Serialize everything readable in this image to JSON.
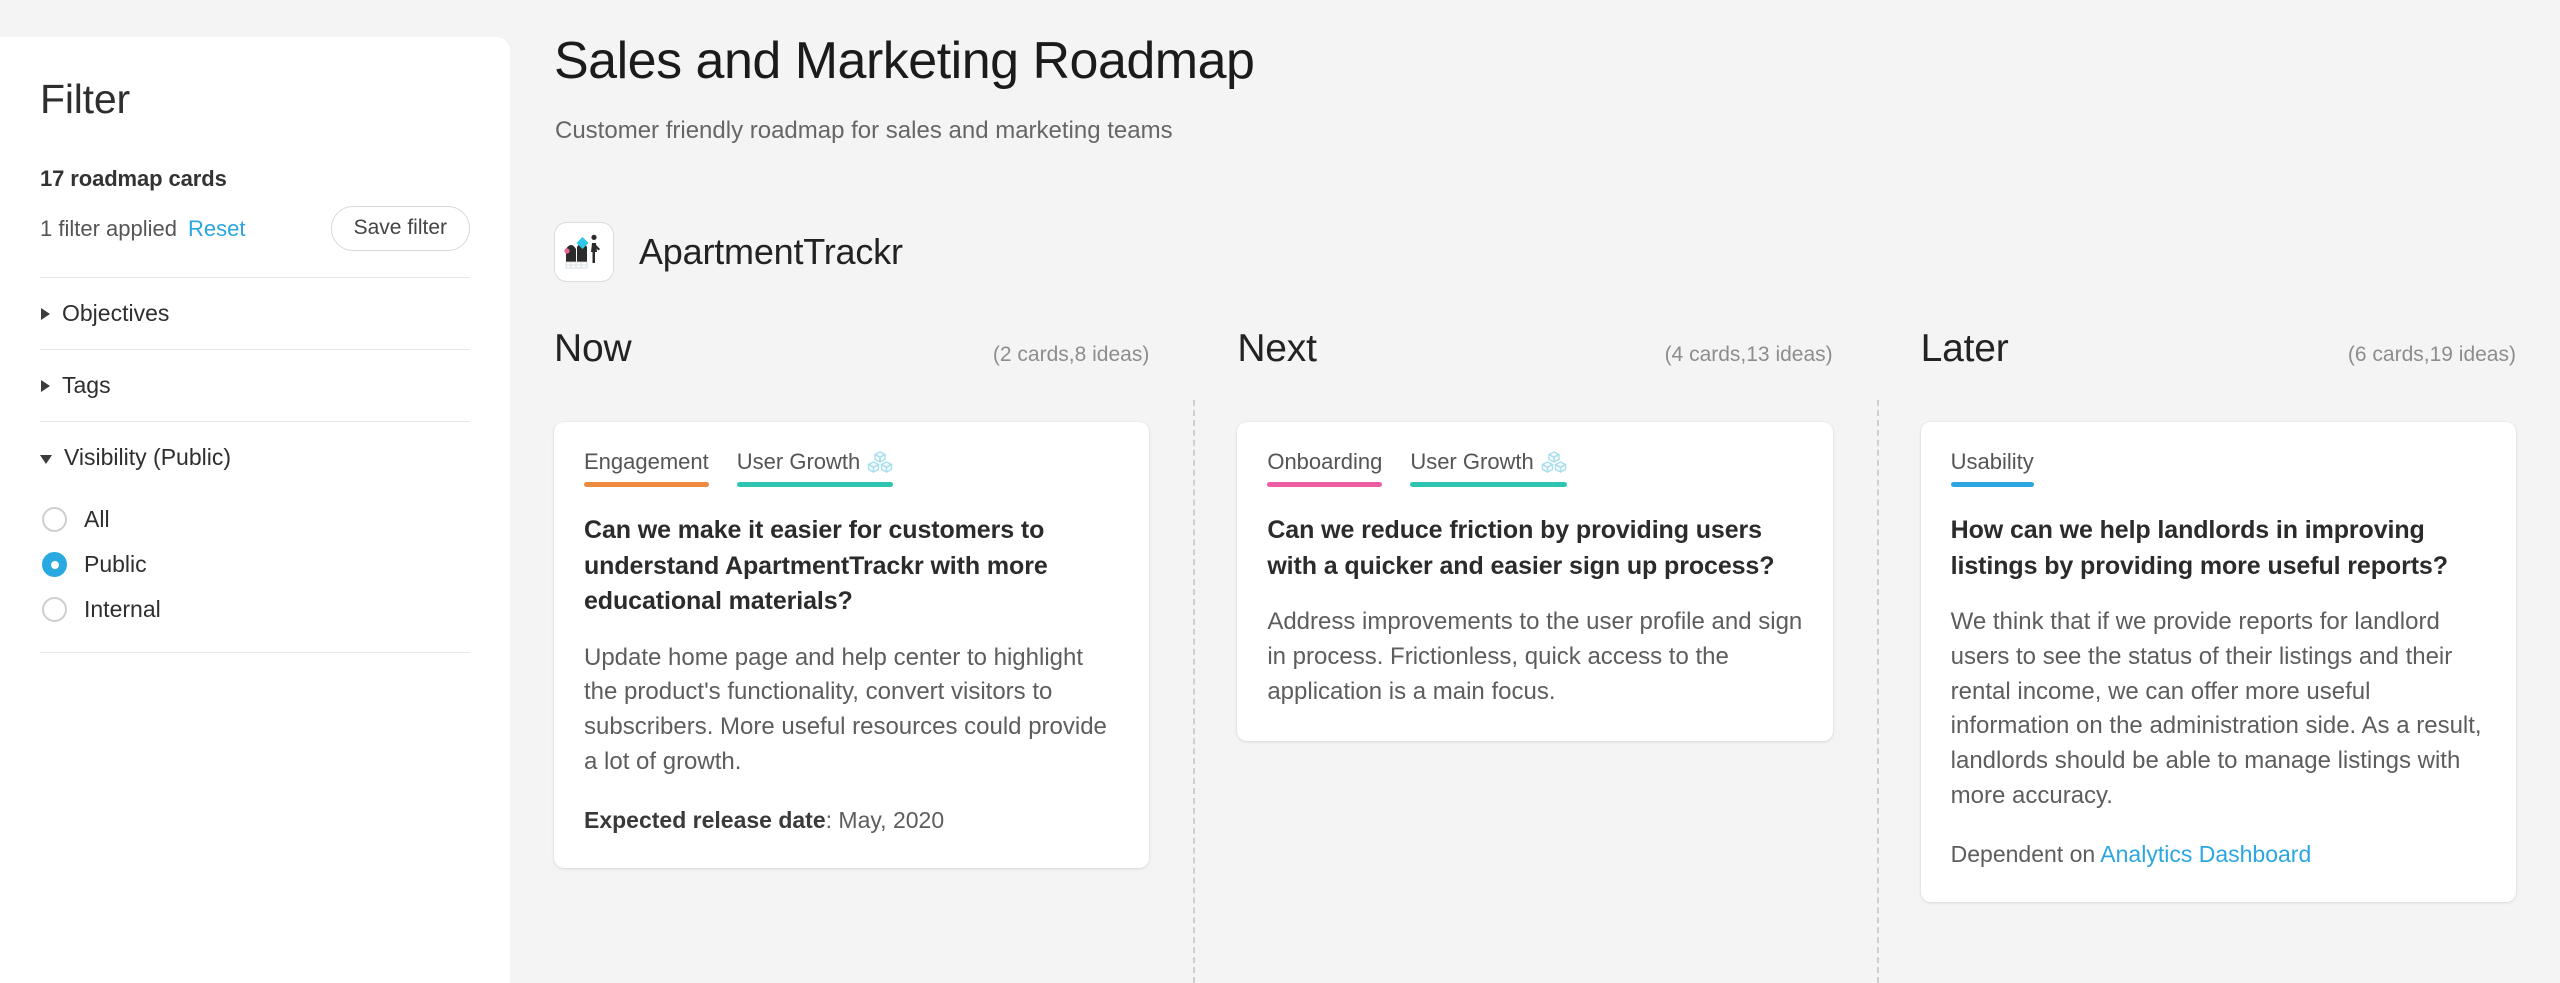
{
  "filter_panel": {
    "title": "Filter",
    "card_count": "17 roadmap cards",
    "filters_applied": "1 filter applied",
    "reset_label": "Reset",
    "save_filter_label": "Save filter",
    "sections": [
      {
        "label": "Objectives",
        "expanded": false
      },
      {
        "label": "Tags",
        "expanded": false
      },
      {
        "label": "Visibility (Public)",
        "expanded": true
      }
    ],
    "visibility_options": [
      {
        "label": "All",
        "selected": false
      },
      {
        "label": "Public",
        "selected": true
      },
      {
        "label": "Internal",
        "selected": false
      }
    ],
    "accent_color": "#29a9e0",
    "link_color": "#2ba6e0"
  },
  "header": {
    "title": "Sales and Marketing Roadmap",
    "subtitle": "Customer friendly roadmap for sales and marketing teams"
  },
  "product": {
    "name": "ApartmentTrackr",
    "logo_icon": "apartment-buildings-icon"
  },
  "columns": [
    {
      "title": "Now",
      "meta": "(2 cards,8 ideas)",
      "card": {
        "tags": [
          {
            "label": "Engagement",
            "color": "#ef8b3f",
            "has_objective_icon": false
          },
          {
            "label": "User Growth",
            "color": "#2ec4b1",
            "has_objective_icon": true
          }
        ],
        "title": "Can we make it easier for customers to understand ApartmentTrackr with more educational materials?",
        "description": "Update home page and help center to highlight the product's functionality, convert visitors to subscribers. More useful resources could provide a lot of growth.",
        "footer_label": "Expected release date",
        "footer_separator": ": ",
        "footer_value": "May, 2020",
        "footer_link": ""
      }
    },
    {
      "title": "Next",
      "meta": "(4 cards,13 ideas)",
      "card": {
        "tags": [
          {
            "label": "Onboarding",
            "color": "#ee5ea5",
            "has_objective_icon": false
          },
          {
            "label": "User Growth",
            "color": "#2ec4b1",
            "has_objective_icon": true
          }
        ],
        "title": "Can we reduce friction by providing users with a quicker and easier sign up process?",
        "description": "Address improvements to the user profile and sign in process. Frictionless, quick access to the application is a main focus.",
        "footer_label": "",
        "footer_separator": "",
        "footer_value": "",
        "footer_link": ""
      }
    },
    {
      "title": "Later",
      "meta": "(6 cards,19 ideas)",
      "card": {
        "tags": [
          {
            "label": "Usability",
            "color": "#2ba6e0",
            "has_objective_icon": false
          }
        ],
        "title": "How can we help landlords in improving listings by providing more useful reports?",
        "description": "We think that if we provide reports for landlord users to see the status of their listings and their rental income, we can offer more useful information on the administration side. As a result, landlords should be able to manage listings with more accuracy.",
        "footer_label": "",
        "footer_separator": "Dependent on ",
        "footer_value": "",
        "footer_link": "Analytics Dashboard"
      }
    }
  ]
}
